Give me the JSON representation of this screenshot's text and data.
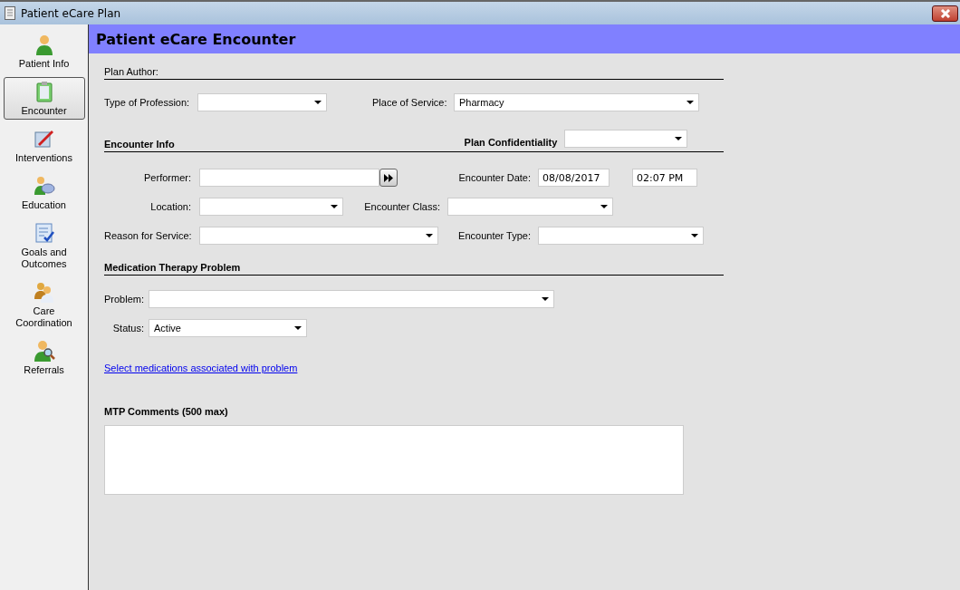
{
  "window": {
    "title": "Patient eCare Plan"
  },
  "sidebar": {
    "items": [
      {
        "label": "Patient Info",
        "kind": "person",
        "selected": false
      },
      {
        "label": "Encounter",
        "kind": "clipboard",
        "selected": true
      },
      {
        "label": "Interventions",
        "kind": "pen",
        "selected": false
      },
      {
        "label": "Education",
        "kind": "speech",
        "selected": false
      },
      {
        "label": "Goals and Outcomes",
        "kind": "checklist",
        "selected": false
      },
      {
        "label": "Care Coordination",
        "kind": "group",
        "selected": false
      },
      {
        "label": "Referrals",
        "kind": "magnifier",
        "selected": false
      }
    ]
  },
  "header": {
    "title": "Patient eCare Encounter"
  },
  "plan_author": {
    "label": "Plan Author:"
  },
  "profession": {
    "label": "Type of Profession:"
  },
  "place_of_service": {
    "label": "Place of Service:",
    "value": "Pharmacy"
  },
  "encounter_info": {
    "heading": "Encounter Info",
    "confidentiality_label": "Plan Confidentiality",
    "performer": {
      "label": "Performer:"
    },
    "encounter_date": {
      "label": "Encounter Date:",
      "date": "08/08/2017",
      "time": "02:07 PM"
    },
    "location": {
      "label": "Location:"
    },
    "encounter_class": {
      "label": "Encounter Class:"
    },
    "reason": {
      "label": "Reason for Service:"
    },
    "encounter_type": {
      "label": "Encounter Type:"
    }
  },
  "mtp": {
    "heading": "Medication Therapy Problem",
    "problem": {
      "label": "Problem:"
    },
    "status": {
      "label": "Status:",
      "value": "Active"
    },
    "link": "Select medications associated with problem"
  },
  "comments": {
    "heading": "MTP Comments (500 max)"
  }
}
